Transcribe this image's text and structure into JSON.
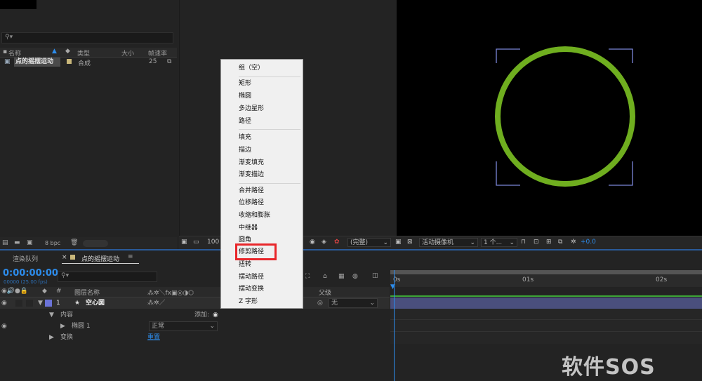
{
  "project": {
    "columns": {
      "name": "名称",
      "type": "类型",
      "size": "大小",
      "fps": "帧速率"
    },
    "item": {
      "name": "点的摇摆运动",
      "type": "合成",
      "fps": "25"
    },
    "bpc": "8 bpc"
  },
  "viewer": {
    "zoom": "100",
    "resolution": "(完整)",
    "camera": "活动摄像机",
    "views": "1 个...",
    "exposure": "+0.0",
    "circle_color": "#6fae1f",
    "guide_color": "#7b86d9"
  },
  "timeline": {
    "tab_render_queue": "渲染队列",
    "tab_comp": "点的摇摆运动",
    "timecode": "0:00:00:00",
    "fps_info": "00000 (25.00 fps)",
    "header": {
      "hash": "#",
      "layer_name": "图层名称",
      "parent": "父级"
    },
    "layer": {
      "number": "1",
      "name": "空心圆",
      "parent_value": "无"
    },
    "content_label": "内容",
    "add_label": "添加:",
    "ellipse_label": "椭圆 1",
    "blend_mode": "正常",
    "transform_label": "变换",
    "reset_label": "重置",
    "ruler": [
      "0s",
      "01s",
      "02s"
    ]
  },
  "menu": {
    "items": [
      "组（空）",
      "矩形",
      "椭圆",
      "多边星形",
      "路径",
      "填充",
      "描边",
      "渐变填充",
      "渐变描边",
      "合并路径",
      "位移路径",
      "收缩和膨胀",
      "中继器",
      "圆角",
      "修剪路径",
      "扭转",
      "摆动路径",
      "摆动变换",
      "Z 字形"
    ],
    "highlighted": "修剪路径",
    "highlight_color": "#e8262a"
  },
  "watermark": "软件SOS"
}
